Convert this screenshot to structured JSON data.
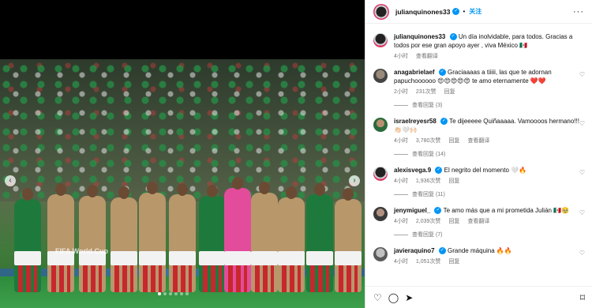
{
  "media": {
    "watermark": "FIFA World Cup",
    "nav_prev": "‹",
    "nav_next": "›",
    "slide_count": 6,
    "active_slide": 0
  },
  "header": {
    "username": "julianquinones33",
    "follow_label": "关注",
    "separator": "•",
    "more_label": "···"
  },
  "caption": {
    "username": "julianquinones33",
    "text": "Un día inolvidable, para todos. Gracias a todos por ese gran apoyo ayer , viva México 🇲🇽",
    "time": "4小时",
    "translate": "查看翻译"
  },
  "comments": [
    {
      "username": "anagabrielaef",
      "text": "Graciaaaas a tiiiii, las que te adornan papuchoooooo 😍😍😍😍😍 te amo eternamente ❤️❤️",
      "time": "2小时",
      "likes": "231次赞",
      "reply": "回复",
      "replies": "查看回复 (3)",
      "verified": true
    },
    {
      "username": "israelreyesr58",
      "text": "Te dijeeeee Quiñaaaaa. Vamoooos hermano!!! 👏🏻🤍🙌🏻",
      "time": "4小时",
      "likes": "3,780次赞",
      "reply": "回复",
      "translate": "查看翻译",
      "replies": "查看回复 (14)",
      "verified": true
    },
    {
      "username": "alexisvega.9",
      "text": "El negrito del momento 🤍🔥",
      "time": "4小时",
      "likes": "1,936次赞",
      "reply": "回复",
      "replies": "查看回复 (11)",
      "verified": true
    },
    {
      "username": "jenymiguel_",
      "text": "Te amo más que a mi prometida Julián 🇲🇽🥹",
      "time": "4小时",
      "likes": "2,039次赞",
      "reply": "回复",
      "translate": "查看翻译",
      "replies": "查看回复 (7)",
      "verified": true
    },
    {
      "username": "javieraquino7",
      "text": "Grande máquina 🔥🔥",
      "time": "4小时",
      "likes": "1,051次赞",
      "reply": "回复",
      "verified": true
    }
  ],
  "actions": {
    "like_icon": "heart-outline-icon",
    "comment_icon": "comment-icon",
    "share_icon": "share-icon",
    "save_icon": "bookmark-icon"
  },
  "colors": {
    "accent": "#0095f6",
    "muted": "#737373",
    "jersey_green": "#1e7a3c",
    "jersey_tan": "#b8976b"
  }
}
